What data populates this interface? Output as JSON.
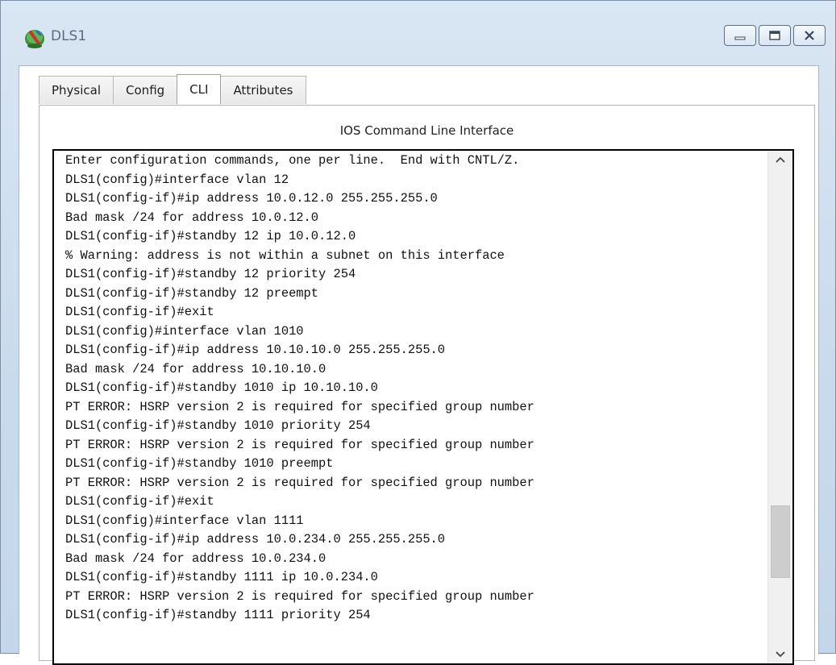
{
  "window": {
    "title": "DLS1",
    "icon": "router-icon",
    "controls": {
      "minimize_icon": "minimize-icon",
      "maximize_icon": "maximize-icon",
      "close_icon": "close-icon"
    }
  },
  "tabs": [
    {
      "label": "Physical",
      "active": false
    },
    {
      "label": "Config",
      "active": false
    },
    {
      "label": "CLI",
      "active": true
    },
    {
      "label": "Attributes",
      "active": false
    }
  ],
  "cli": {
    "heading": "IOS Command Line Interface",
    "lines": [
      "Enter configuration commands, one per line.  End with CNTL/Z.",
      "DLS1(config)#interface vlan 12",
      "DLS1(config-if)#ip address 10.0.12.0 255.255.255.0",
      "Bad mask /24 for address 10.0.12.0",
      "DLS1(config-if)#standby 12 ip 10.0.12.0",
      "% Warning: address is not within a subnet on this interface",
      "DLS1(config-if)#standby 12 priority 254",
      "DLS1(config-if)#standby 12 preempt",
      "DLS1(config-if)#exit",
      "DLS1(config)#interface vlan 1010",
      "DLS1(config-if)#ip address 10.10.10.0 255.255.255.0",
      "Bad mask /24 for address 10.10.10.0",
      "DLS1(config-if)#standby 1010 ip 10.10.10.0",
      "PT ERROR: HSRP version 2 is required for specified group number",
      "DLS1(config-if)#standby 1010 priority 254",
      "PT ERROR: HSRP version 2 is required for specified group number",
      "DLS1(config-if)#standby 1010 preempt",
      "PT ERROR: HSRP version 2 is required for specified group number",
      "DLS1(config-if)#exit",
      "DLS1(config)#interface vlan 1111",
      "DLS1(config-if)#ip address 10.0.234.0 255.255.255.0",
      "Bad mask /24 for address 10.0.234.0",
      "DLS1(config-if)#standby 1111 ip 10.0.234.0",
      "PT ERROR: HSRP version 2 is required for specified group number",
      "DLS1(config-if)#standby 1111 priority 254"
    ],
    "scrollbar": {
      "up_icon": "scroll-up-arrow-icon",
      "down_icon": "scroll-down-arrow-icon"
    }
  }
}
